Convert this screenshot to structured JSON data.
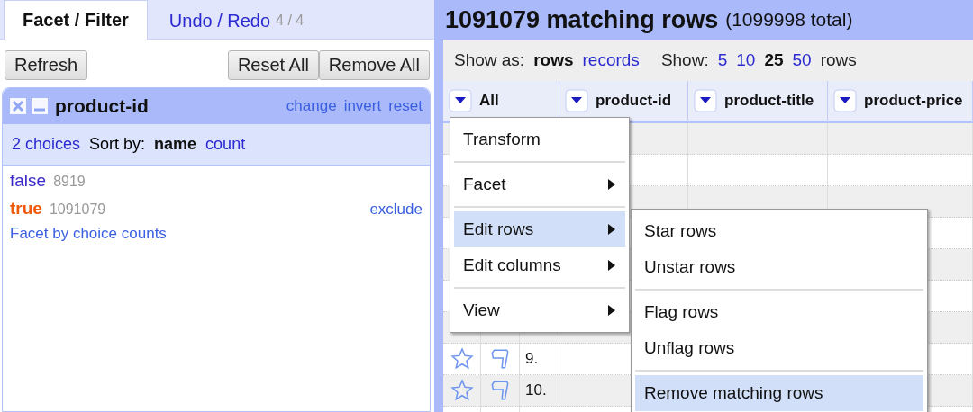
{
  "tabs": [
    {
      "label": "Facet / Filter",
      "selected": true
    },
    {
      "label": "Undo / Redo",
      "count": "4 / 4",
      "selected": false
    }
  ],
  "buttons": {
    "left": [
      "Refresh"
    ],
    "right": [
      "Reset All",
      "Remove All"
    ]
  },
  "facet": {
    "title": "product-id",
    "actions": [
      "change",
      "invert",
      "reset"
    ],
    "choices_count": "2 choices",
    "sort_label": "Sort by:",
    "sort_options": [
      {
        "label": "name",
        "selected": true
      },
      {
        "label": "count",
        "selected": false
      }
    ],
    "choices": [
      {
        "name": "false",
        "count": "8919",
        "selected": false
      },
      {
        "name": "true",
        "count": "1091079",
        "selected": true,
        "action": "exclude"
      }
    ],
    "footer_link": "Facet by choice counts"
  },
  "summary": {
    "matching": "1091079 matching rows",
    "total": "(1099998 total)"
  },
  "view_bar": {
    "show_as_label": "Show as:",
    "modes": [
      {
        "label": "rows",
        "selected": true
      },
      {
        "label": "records",
        "selected": false
      }
    ],
    "show_label": "Show:",
    "page_sizes": [
      {
        "label": "5",
        "selected": false
      },
      {
        "label": "10",
        "selected": false
      },
      {
        "label": "25",
        "selected": true
      },
      {
        "label": "50",
        "selected": false
      }
    ],
    "suffix": "rows"
  },
  "table": {
    "columns": [
      "All",
      "product-id",
      "product-title",
      "product-price"
    ],
    "rows": [
      {
        "number": "9."
      },
      {
        "number": "10."
      }
    ]
  },
  "menu": {
    "items": [
      {
        "kind": "item",
        "label": "Transform",
        "submenu": false,
        "selected": false
      },
      {
        "kind": "separator"
      },
      {
        "kind": "item",
        "label": "Facet",
        "submenu": true,
        "selected": false
      },
      {
        "kind": "separator"
      },
      {
        "kind": "item",
        "label": "Edit rows",
        "submenu": true,
        "selected": true
      },
      {
        "kind": "item",
        "label": "Edit columns",
        "submenu": true,
        "selected": false
      },
      {
        "kind": "separator"
      },
      {
        "kind": "item",
        "label": "View",
        "submenu": true,
        "selected": false
      }
    ]
  },
  "submenu": {
    "items": [
      {
        "kind": "item",
        "label": "Star rows",
        "submenu": false,
        "selected": false
      },
      {
        "kind": "item",
        "label": "Unstar rows",
        "submenu": false,
        "selected": false
      },
      {
        "kind": "separator"
      },
      {
        "kind": "item",
        "label": "Flag rows",
        "submenu": false,
        "selected": false
      },
      {
        "kind": "item",
        "label": "Unflag rows",
        "submenu": false,
        "selected": false
      },
      {
        "kind": "separator"
      },
      {
        "kind": "item",
        "label": "Remove matching rows",
        "submenu": false,
        "selected": true
      }
    ]
  }
}
